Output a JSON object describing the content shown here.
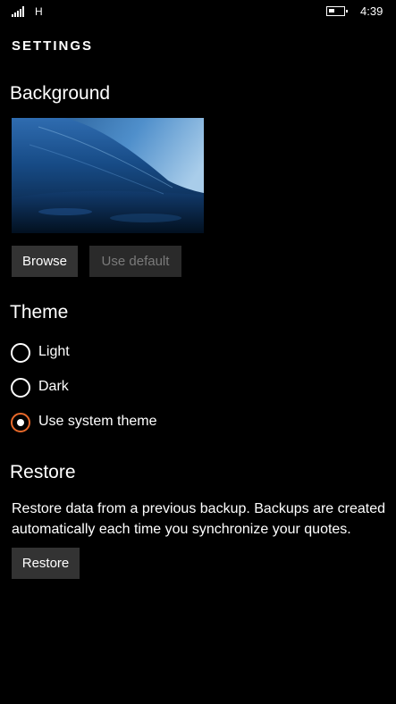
{
  "status_bar": {
    "network": "H",
    "time": "4:39"
  },
  "page_title": "SETTINGS",
  "background_section": {
    "title": "Background",
    "browse_label": "Browse",
    "use_default_label": "Use default"
  },
  "theme_section": {
    "title": "Theme",
    "options": [
      {
        "label": "Light",
        "selected": false
      },
      {
        "label": "Dark",
        "selected": false
      },
      {
        "label": "Use system theme",
        "selected": true
      }
    ]
  },
  "restore_section": {
    "title": "Restore",
    "description": "Restore data from a previous backup. Backups are created automatically each time you synchronize your quotes.",
    "restore_label": "Restore"
  },
  "colors": {
    "accent": "#e8692a",
    "background": "#000000",
    "button": "#333333"
  }
}
